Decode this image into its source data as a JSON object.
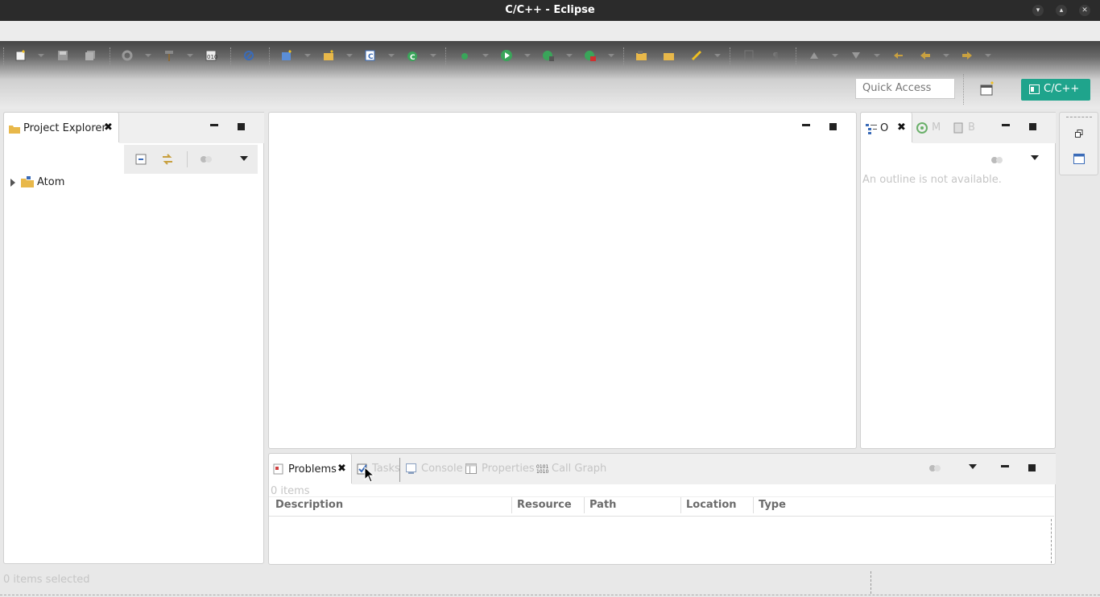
{
  "window": {
    "title": "C/C++ - Eclipse"
  },
  "toolbar": {
    "quick_access_placeholder": "Quick Access",
    "perspective_label": "C/C++"
  },
  "project_explorer": {
    "tab_label": "Project Explorer",
    "tree": [
      {
        "label": "Atom"
      }
    ]
  },
  "outline": {
    "tab_label": "O",
    "tab2_label": "M",
    "tab3_label": "B",
    "empty_message": "An outline is not available."
  },
  "bottom_panel": {
    "tabs": [
      {
        "label": "Problems",
        "active": true
      },
      {
        "label": "Tasks"
      },
      {
        "label": "Console"
      },
      {
        "label": "Properties"
      },
      {
        "label": "Call Graph"
      }
    ],
    "items_count": "0 items",
    "columns": [
      "Description",
      "Resource",
      "Path",
      "Location",
      "Type"
    ]
  },
  "status_bar": {
    "text": "0 items selected"
  },
  "colors": {
    "accent": "#1fa48c",
    "titlebar": "#2b2b2b"
  }
}
